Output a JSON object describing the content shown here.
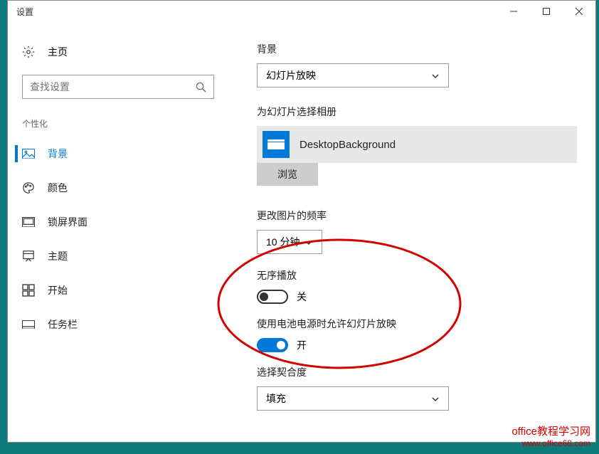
{
  "titlebar": {
    "title": "设置"
  },
  "sidebar": {
    "home": "主页",
    "search_placeholder": "查找设置",
    "section": "个性化",
    "items": [
      {
        "label": "背景",
        "icon": "picture-icon",
        "active": true
      },
      {
        "label": "颜色",
        "icon": "palette-icon",
        "active": false
      },
      {
        "label": "锁屏界面",
        "icon": "lockscreen-icon",
        "active": false
      },
      {
        "label": "主题",
        "icon": "theme-icon",
        "active": false
      },
      {
        "label": "开始",
        "icon": "start-icon",
        "active": false
      },
      {
        "label": "任务栏",
        "icon": "taskbar-icon",
        "active": false
      }
    ]
  },
  "content": {
    "background_label": "背景",
    "background_value": "幻灯片放映",
    "album_label": "为幻灯片选择相册",
    "album_name": "DesktopBackground",
    "browse": "浏览",
    "frequency_label": "更改图片的频率",
    "frequency_value": "10 分钟",
    "shuffle_label": "无序播放",
    "shuffle_state": "关",
    "battery_label": "使用电池电源时允许幻灯片放映",
    "battery_state": "开",
    "fit_label": "选择契合度",
    "fit_value": "填充"
  },
  "watermark": {
    "line1": "office教程学习网",
    "line2": "www.office68.com"
  }
}
